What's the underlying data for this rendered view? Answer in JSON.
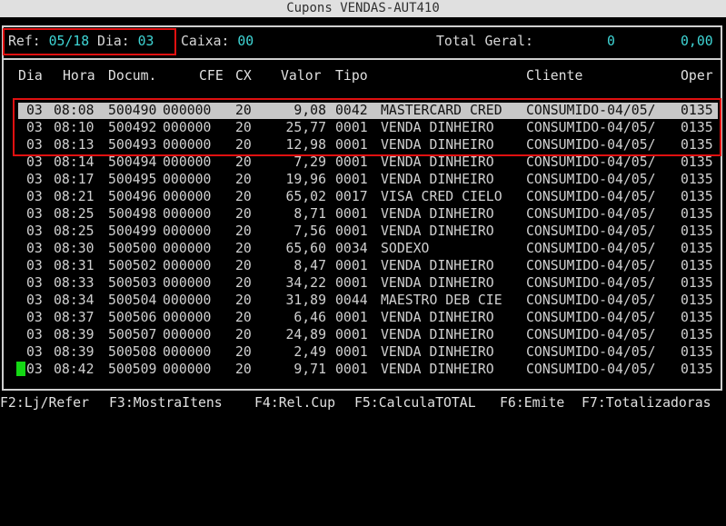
{
  "window": {
    "title": "Cupons VENDAS-AUT410"
  },
  "header": {
    "ref_label": "Ref:",
    "ref_value": "05/18",
    "dia_label": "Dia:",
    "dia_value": "03",
    "caixa_label": "Caixa:",
    "caixa_value": "00",
    "total_label": "Total Geral:",
    "total_count": "0",
    "total_value": "0,00"
  },
  "columns": {
    "dia": "Dia",
    "hora": "Hora",
    "docum": "Docum.",
    "cfe": "CFE",
    "cx": "CX",
    "valor": "Valor",
    "tipo": "Tipo",
    "cliente": "Cliente",
    "oper": "Oper"
  },
  "rows": [
    {
      "dia": "03",
      "hora": "08:08",
      "docum": "500490",
      "cfe": "000000",
      "cx": "20",
      "valor": "9,08",
      "cod": "0042",
      "tipo": "MASTERCARD CRED",
      "cliente": "CONSUMIDO-04/05/",
      "oper": "0135"
    },
    {
      "dia": "03",
      "hora": "08:10",
      "docum": "500492",
      "cfe": "000000",
      "cx": "20",
      "valor": "25,77",
      "cod": "0001",
      "tipo": "VENDA DINHEIRO",
      "cliente": "CONSUMIDO-04/05/",
      "oper": "0135"
    },
    {
      "dia": "03",
      "hora": "08:13",
      "docum": "500493",
      "cfe": "000000",
      "cx": "20",
      "valor": "12,98",
      "cod": "0001",
      "tipo": "VENDA DINHEIRO",
      "cliente": "CONSUMIDO-04/05/",
      "oper": "0135"
    },
    {
      "dia": "03",
      "hora": "08:14",
      "docum": "500494",
      "cfe": "000000",
      "cx": "20",
      "valor": "7,29",
      "cod": "0001",
      "tipo": "VENDA DINHEIRO",
      "cliente": "CONSUMIDO-04/05/",
      "oper": "0135"
    },
    {
      "dia": "03",
      "hora": "08:17",
      "docum": "500495",
      "cfe": "000000",
      "cx": "20",
      "valor": "19,96",
      "cod": "0001",
      "tipo": "VENDA DINHEIRO",
      "cliente": "CONSUMIDO-04/05/",
      "oper": "0135"
    },
    {
      "dia": "03",
      "hora": "08:21",
      "docum": "500496",
      "cfe": "000000",
      "cx": "20",
      "valor": "65,02",
      "cod": "0017",
      "tipo": "VISA CRED CIELO",
      "cliente": "CONSUMIDO-04/05/",
      "oper": "0135"
    },
    {
      "dia": "03",
      "hora": "08:25",
      "docum": "500498",
      "cfe": "000000",
      "cx": "20",
      "valor": "8,71",
      "cod": "0001",
      "tipo": "VENDA DINHEIRO",
      "cliente": "CONSUMIDO-04/05/",
      "oper": "0135"
    },
    {
      "dia": "03",
      "hora": "08:25",
      "docum": "500499",
      "cfe": "000000",
      "cx": "20",
      "valor": "7,56",
      "cod": "0001",
      "tipo": "VENDA DINHEIRO",
      "cliente": "CONSUMIDO-04/05/",
      "oper": "0135"
    },
    {
      "dia": "03",
      "hora": "08:30",
      "docum": "500500",
      "cfe": "000000",
      "cx": "20",
      "valor": "65,60",
      "cod": "0034",
      "tipo": "SODEXO",
      "cliente": "CONSUMIDO-04/05/",
      "oper": "0135"
    },
    {
      "dia": "03",
      "hora": "08:31",
      "docum": "500502",
      "cfe": "000000",
      "cx": "20",
      "valor": "8,47",
      "cod": "0001",
      "tipo": "VENDA DINHEIRO",
      "cliente": "CONSUMIDO-04/05/",
      "oper": "0135"
    },
    {
      "dia": "03",
      "hora": "08:33",
      "docum": "500503",
      "cfe": "000000",
      "cx": "20",
      "valor": "34,22",
      "cod": "0001",
      "tipo": "VENDA DINHEIRO",
      "cliente": "CONSUMIDO-04/05/",
      "oper": "0135"
    },
    {
      "dia": "03",
      "hora": "08:34",
      "docum": "500504",
      "cfe": "000000",
      "cx": "20",
      "valor": "31,89",
      "cod": "0044",
      "tipo": "MAESTRO DEB CIE",
      "cliente": "CONSUMIDO-04/05/",
      "oper": "0135"
    },
    {
      "dia": "03",
      "hora": "08:37",
      "docum": "500506",
      "cfe": "000000",
      "cx": "20",
      "valor": "6,46",
      "cod": "0001",
      "tipo": "VENDA DINHEIRO",
      "cliente": "CONSUMIDO-04/05/",
      "oper": "0135"
    },
    {
      "dia": "03",
      "hora": "08:39",
      "docum": "500507",
      "cfe": "000000",
      "cx": "20",
      "valor": "24,89",
      "cod": "0001",
      "tipo": "VENDA DINHEIRO",
      "cliente": "CONSUMIDO-04/05/",
      "oper": "0135"
    },
    {
      "dia": "03",
      "hora": "08:39",
      "docum": "500508",
      "cfe": "000000",
      "cx": "20",
      "valor": "2,49",
      "cod": "0001",
      "tipo": "VENDA DINHEIRO",
      "cliente": "CONSUMIDO-04/05/",
      "oper": "0135"
    },
    {
      "dia": "03",
      "hora": "08:42",
      "docum": "500509",
      "cfe": "000000",
      "cx": "20",
      "valor": "9,71",
      "cod": "0001",
      "tipo": "VENDA DINHEIRO",
      "cliente": "CONSUMIDO-04/05/",
      "oper": "0135"
    }
  ],
  "selected_row": 0,
  "footer": {
    "f2": "F2:Lj/Refer",
    "f3": "F3:MostraItens",
    "f4": "F4:Rel.Cup",
    "f5": "F5:CalculaTOTAL",
    "f6": "F6:Emite",
    "f7": "F7:Totalizadoras"
  },
  "colors": {
    "accent": "#3fd6d6",
    "highlight_box": "#e01010",
    "cursor": "#14d814",
    "selected_row_bg": "#c8c8c8"
  }
}
